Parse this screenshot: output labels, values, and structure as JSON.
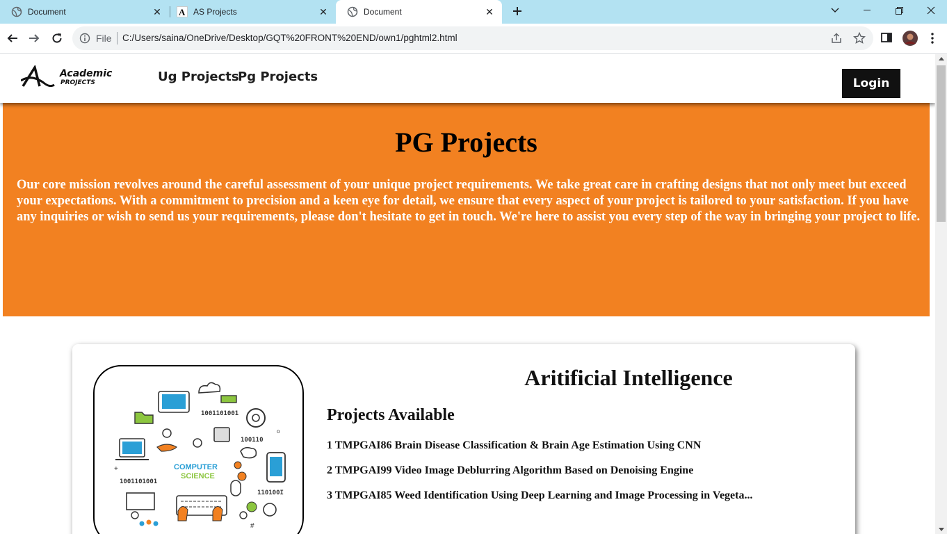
{
  "browser": {
    "tabs": [
      {
        "title": "Document",
        "icon": "globe-icon",
        "active": false
      },
      {
        "title": "AS Projects",
        "icon": "site-logo-icon",
        "active": false
      },
      {
        "title": "Document",
        "icon": "globe-icon",
        "active": true
      }
    ],
    "address": {
      "scheme_label": "File",
      "url": "C:/Users/saina/OneDrive/Desktop/GQT%20FRONT%20END/own1/pghtml2.html"
    }
  },
  "site": {
    "logo_text": "Academic",
    "logo_subtext": "PROJECTS",
    "nav": {
      "ug": "Ug Projects",
      "pg": "Pg Projects",
      "login": "Login"
    },
    "hero": {
      "title": "PG Projects",
      "text": "Our core mission revolves around the careful assessment of your unique project requirements. We take great care in crafting designs that not only meet but exceed your expectations. With a commitment to precision and a keen eye for detail, we ensure that every aspect of your project is tailored to your satisfaction. If you have any inquiries or wish to send us your requirements, please don't hesitate to get in touch. We're here to assist you every step of the way in bringing your project to life."
    },
    "card": {
      "title": "Aritificial Intelligence",
      "subtitle": "Projects Available",
      "image_label_1": "COMPUTER",
      "image_label_2": "SCIENCE",
      "projects": [
        "1 TMPGAI86 Brain Disease Classification & Brain Age Estimation Using CNN",
        "2 TMPGAI99 Video Image Deblurring Algorithm Based on Denoising Engine",
        "3 TMPGAI85 Weed Identification Using Deep Learning and Image Processing in Vegeta..."
      ]
    }
  },
  "colors": {
    "tabbar": "#b3e2f2",
    "hero": "#f28121",
    "login_bg": "#111111"
  }
}
